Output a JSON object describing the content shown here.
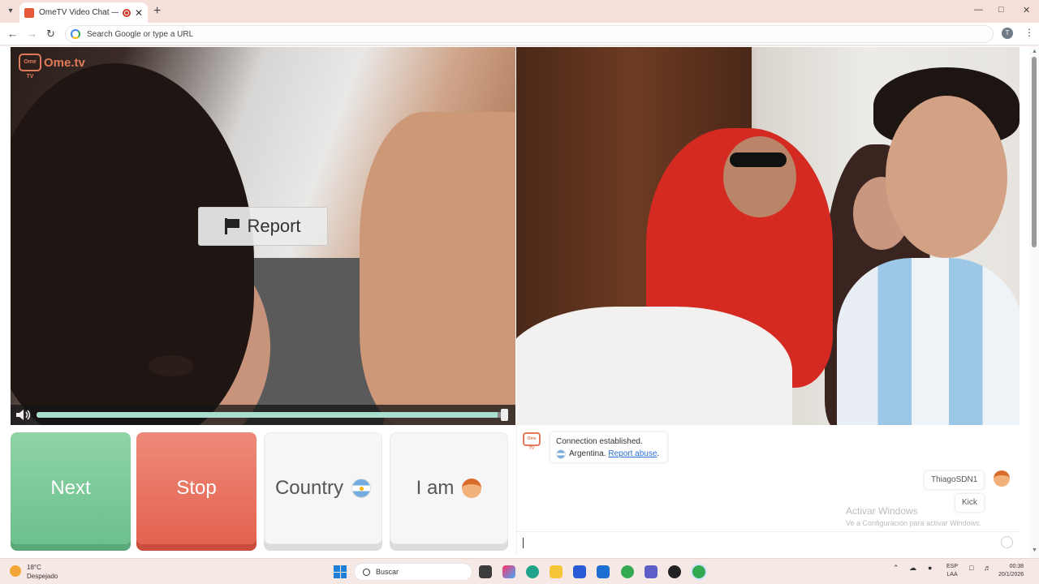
{
  "browser": {
    "tab_title": "OmeTV Video Chat — Ome",
    "new_tab_label": "+",
    "address_placeholder": "Search Google or type a URL",
    "profile_initial": "T"
  },
  "page": {
    "logo_text": "Ome.tv",
    "logo_badge": "Ome TV",
    "report_label": "Report",
    "volume_level": 0.98,
    "buttons": {
      "next": "Next",
      "stop": "Stop",
      "country": "Country",
      "i_am": "I am"
    }
  },
  "chat": {
    "connection_message": "Connection established.",
    "country_name": "Argentina.",
    "report_abuse": "Report abuse",
    "report_abuse_suffix": ".",
    "username": "ThiagoSDN1",
    "kick_label": "Kick",
    "activate_title": "Activar Windows",
    "activate_subtitle": "Ve a Configuración para activar Windows."
  },
  "taskbar": {
    "temperature": "18°C",
    "weather_desc": "Despejado",
    "search_label": "Buscar",
    "lang_top": "ESP",
    "lang_bottom": "LAA",
    "time": "00:38",
    "date": "20/1/2026"
  },
  "colors": {
    "next": "#6cc08e",
    "stop": "#e4624f",
    "brand": "#e07a5a",
    "link": "#2a6fd6"
  }
}
